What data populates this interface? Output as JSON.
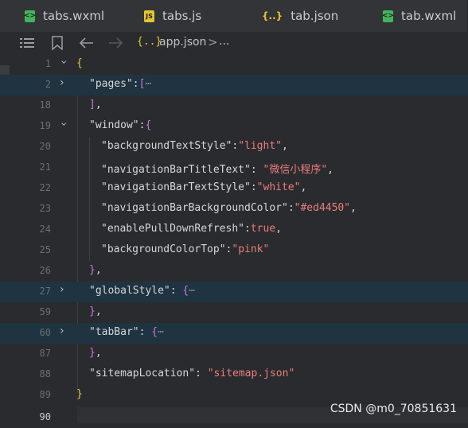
{
  "tabs": [
    {
      "label": "tabs.wxml",
      "icon": "wxml-file-icon",
      "icon_glyph": "<>"
    },
    {
      "label": "tabs.js",
      "icon": "js-file-icon",
      "icon_glyph": "JS"
    },
    {
      "label": "tab.json",
      "icon": "json-file-icon",
      "icon_glyph": "{..}"
    },
    {
      "label": "tab.wxml",
      "icon": "wxml-file-icon",
      "icon_glyph": "<>"
    }
  ],
  "breadcrumb": {
    "json_icon": "{..}",
    "file": "app.json",
    "separator": ">",
    "more": "..."
  },
  "editor": {
    "lines": [
      {
        "n": "1",
        "fold": "v",
        "highlight": false
      },
      {
        "n": "2",
        "fold": ">",
        "highlight": true
      },
      {
        "n": "18",
        "fold": "",
        "highlight": false
      },
      {
        "n": "19",
        "fold": "v",
        "highlight": false
      },
      {
        "n": "20",
        "fold": "",
        "highlight": false
      },
      {
        "n": "21",
        "fold": "",
        "highlight": false
      },
      {
        "n": "22",
        "fold": "",
        "highlight": false
      },
      {
        "n": "23",
        "fold": "",
        "highlight": false
      },
      {
        "n": "24",
        "fold": "",
        "highlight": false
      },
      {
        "n": "25",
        "fold": "",
        "highlight": false
      },
      {
        "n": "26",
        "fold": "",
        "highlight": false
      },
      {
        "n": "27",
        "fold": ">",
        "highlight": true
      },
      {
        "n": "59",
        "fold": "",
        "highlight": false
      },
      {
        "n": "60",
        "fold": ">",
        "highlight": true
      },
      {
        "n": "87",
        "fold": "",
        "highlight": false
      },
      {
        "n": "88",
        "fold": "",
        "highlight": false
      },
      {
        "n": "89",
        "fold": "",
        "highlight": false
      },
      {
        "n": "90",
        "fold": "",
        "highlight": false
      }
    ],
    "tokens": {
      "l1_open": "{",
      "pages_key": "\"pages\"",
      "pages_colon": ":",
      "pages_open": "[",
      "pages_ellipsis": "⋯",
      "l18_close": "]",
      "l18_comma": ",",
      "window_key": "\"window\"",
      "window_colon": ":",
      "window_open": "{",
      "bts_key": "\"backgroundTextStyle\"",
      "bts_colon": ":",
      "bts_val": "\"light\"",
      "bts_comma": ",",
      "nbtt_key": "\"navigationBarTitleText\"",
      "nbtt_colon": ": ",
      "nbtt_val": "\"微信小程序\"",
      "nbtt_comma": ",",
      "nbts_key": "\"navigationBarTextStyle\"",
      "nbts_colon": ":",
      "nbts_val": "\"white\"",
      "nbts_comma": ",",
      "nbbc_key": "\"navigationBarBackgroundColor\"",
      "nbbc_colon": ":",
      "nbbc_val": "\"#ed4450\"",
      "nbbc_comma": ",",
      "epdr_key": "\"enablePullDownRefresh\"",
      "epdr_colon": ":",
      "epdr_val": "true",
      "epdr_comma": ",",
      "bct_key": "\"backgroundColorTop\"",
      "bct_colon": ":",
      "bct_val": "\"pink\"",
      "l26_close": "}",
      "l26_comma": ",",
      "gs_key": "\"globalStyle\"",
      "gs_colon": ": ",
      "gs_open": "{",
      "gs_ellipsis": "⋯",
      "l59_close": "}",
      "l59_comma": ",",
      "tb_key": "\"tabBar\"",
      "tb_colon": ": ",
      "tb_open": "{",
      "tb_ellipsis": "⋯",
      "l87_close": "}",
      "l87_comma": ",",
      "sl_key": "\"sitemapLocation\"",
      "sl_colon": ": ",
      "sl_val": "\"sitemap.json\"",
      "l89_close": "}"
    }
  },
  "watermark": "CSDN @m0_70851631",
  "colors": {
    "background": "#2a2b2e",
    "string": "#e87d7d",
    "bracket_yellow": "#e8c547",
    "bracket_purple": "#c678dd",
    "fold_highlight": "#1f3340"
  }
}
